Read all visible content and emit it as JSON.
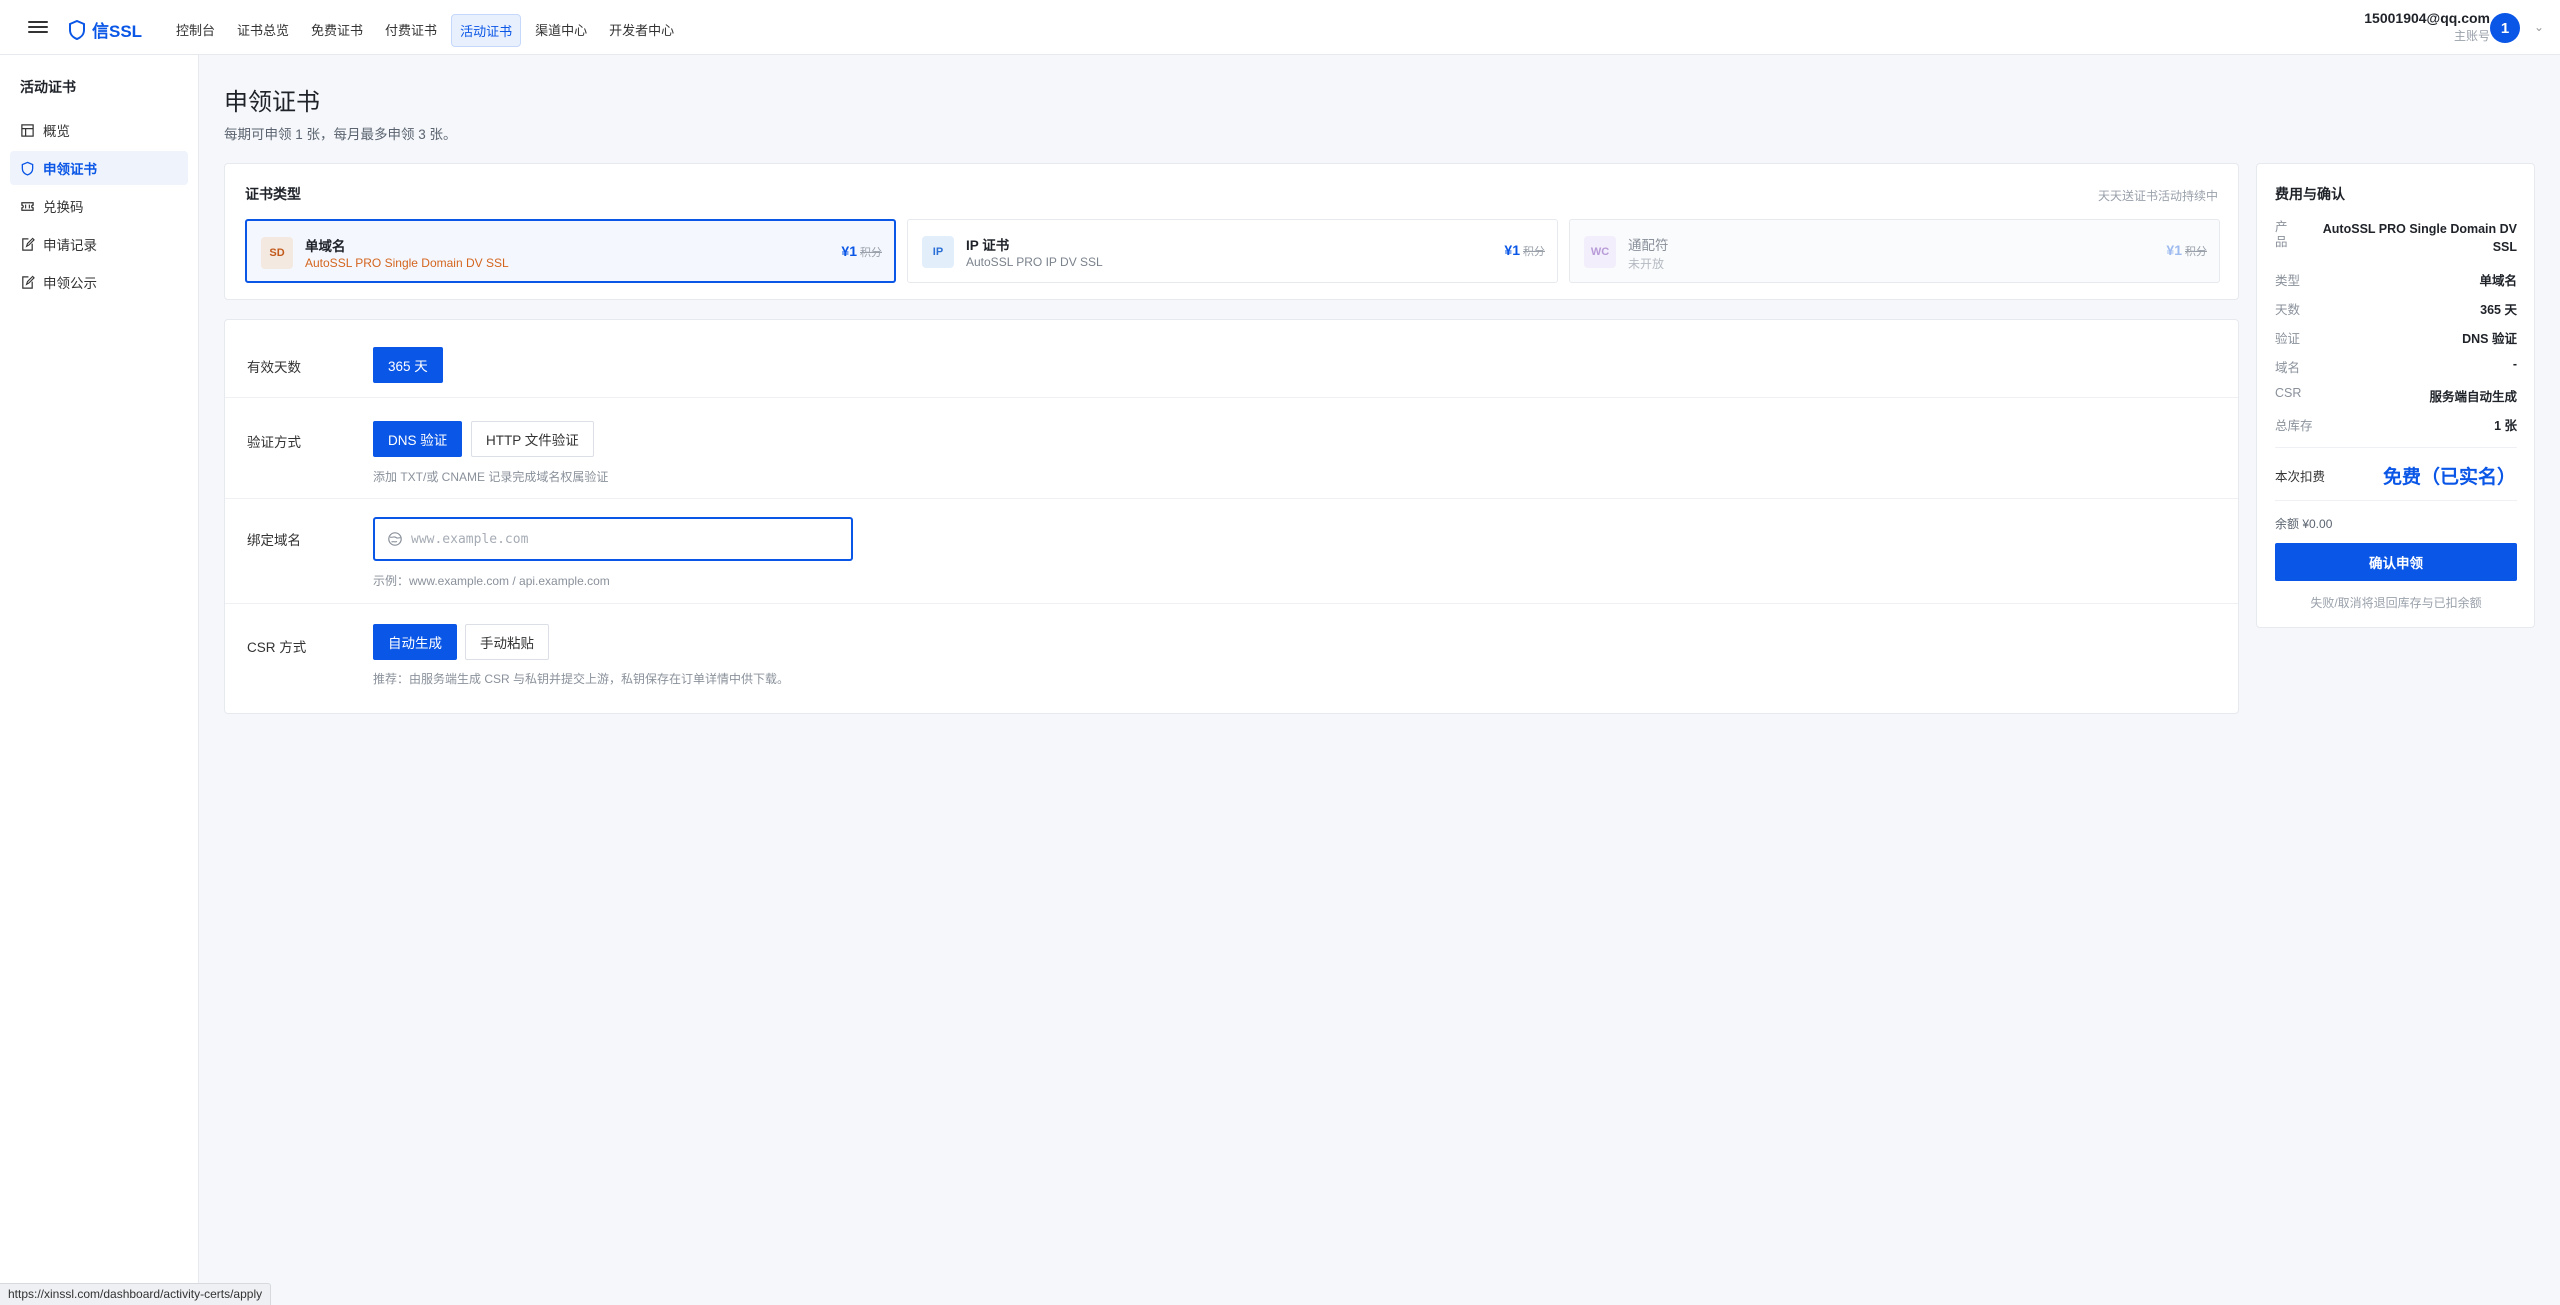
{
  "header": {
    "brand": "信SSL",
    "nav": [
      {
        "label": "控制台"
      },
      {
        "label": "证书总览"
      },
      {
        "label": "免费证书"
      },
      {
        "label": "付费证书"
      },
      {
        "label": "活动证书",
        "active": true
      },
      {
        "label": "渠道中心"
      },
      {
        "label": "开发者中心"
      }
    ],
    "user_email": "15001904@qq.com",
    "user_role": "主账号",
    "avatar_text": "1"
  },
  "sidebar": {
    "title": "活动证书",
    "items": [
      {
        "label": "概览",
        "icon": "layout-icon"
      },
      {
        "label": "申领证书",
        "icon": "shield-icon",
        "active": true
      },
      {
        "label": "兑换码",
        "icon": "ticket-icon"
      },
      {
        "label": "申请记录",
        "icon": "edit-doc-icon"
      },
      {
        "label": "申领公示",
        "icon": "edit-doc-icon"
      }
    ]
  },
  "page": {
    "title": "申领证书",
    "subtitle": "每期可申领 1 张，每月最多申领 3 张。"
  },
  "cert_type": {
    "title": "证书类型",
    "hint": "天天送证书活动持续中",
    "options": [
      {
        "badge": "SD",
        "name": "单域名",
        "desc": "AutoSSL PRO Single Domain DV SSL",
        "price": "¥1",
        "price_note": "积分",
        "selected": true
      },
      {
        "badge": "IP",
        "name": "IP 证书",
        "desc": "AutoSSL PRO IP DV SSL",
        "price": "¥1",
        "price_note": "积分"
      },
      {
        "badge": "WC",
        "name": "通配符",
        "desc": "未开放",
        "price": "¥1",
        "price_note": "积分",
        "disabled": true
      }
    ]
  },
  "form": {
    "validity": {
      "label": "有效天数",
      "option": "365 天"
    },
    "verify": {
      "label": "验证方式",
      "options": [
        "DNS 验证",
        "HTTP 文件验证"
      ],
      "hint": "添加 TXT/或 CNAME 记录完成域名权属验证"
    },
    "domain": {
      "label": "绑定域名",
      "placeholder": "www.example.com",
      "hint": "示例：www.example.com / api.example.com"
    },
    "csr": {
      "label": "CSR 方式",
      "options": [
        "自动生成",
        "手动粘贴"
      ],
      "hint": "推荐：由服务端生成 CSR 与私钥并提交上游，私钥保存在订单详情中供下载。"
    }
  },
  "summary": {
    "title": "费用与确认",
    "rows": [
      {
        "key": "产品",
        "value": "AutoSSL PRO Single Domain DV SSL"
      },
      {
        "key": "类型",
        "value": "单域名"
      },
      {
        "key": "天数",
        "value": "365 天"
      },
      {
        "key": "验证",
        "value": "DNS 验证"
      },
      {
        "key": "域名",
        "value": "-"
      },
      {
        "key": "CSR",
        "value": "服务端自动生成"
      },
      {
        "key": "总库存",
        "value": "1 张"
      }
    ],
    "fee_label": "本次扣费",
    "fee_value": "免费（已实名）",
    "balance": "余额 ¥0.00",
    "confirm": "确认申领",
    "note": "失败/取消将退回库存与已扣余额"
  },
  "status_url": "https://xinssl.com/dashboard/activity-certs/apply",
  "colors": {
    "accent": "#0a56e6",
    "sd_badge": "#f4e9e0",
    "ip_badge": "#e3eefb",
    "wc_badge": "#f3eefb"
  }
}
